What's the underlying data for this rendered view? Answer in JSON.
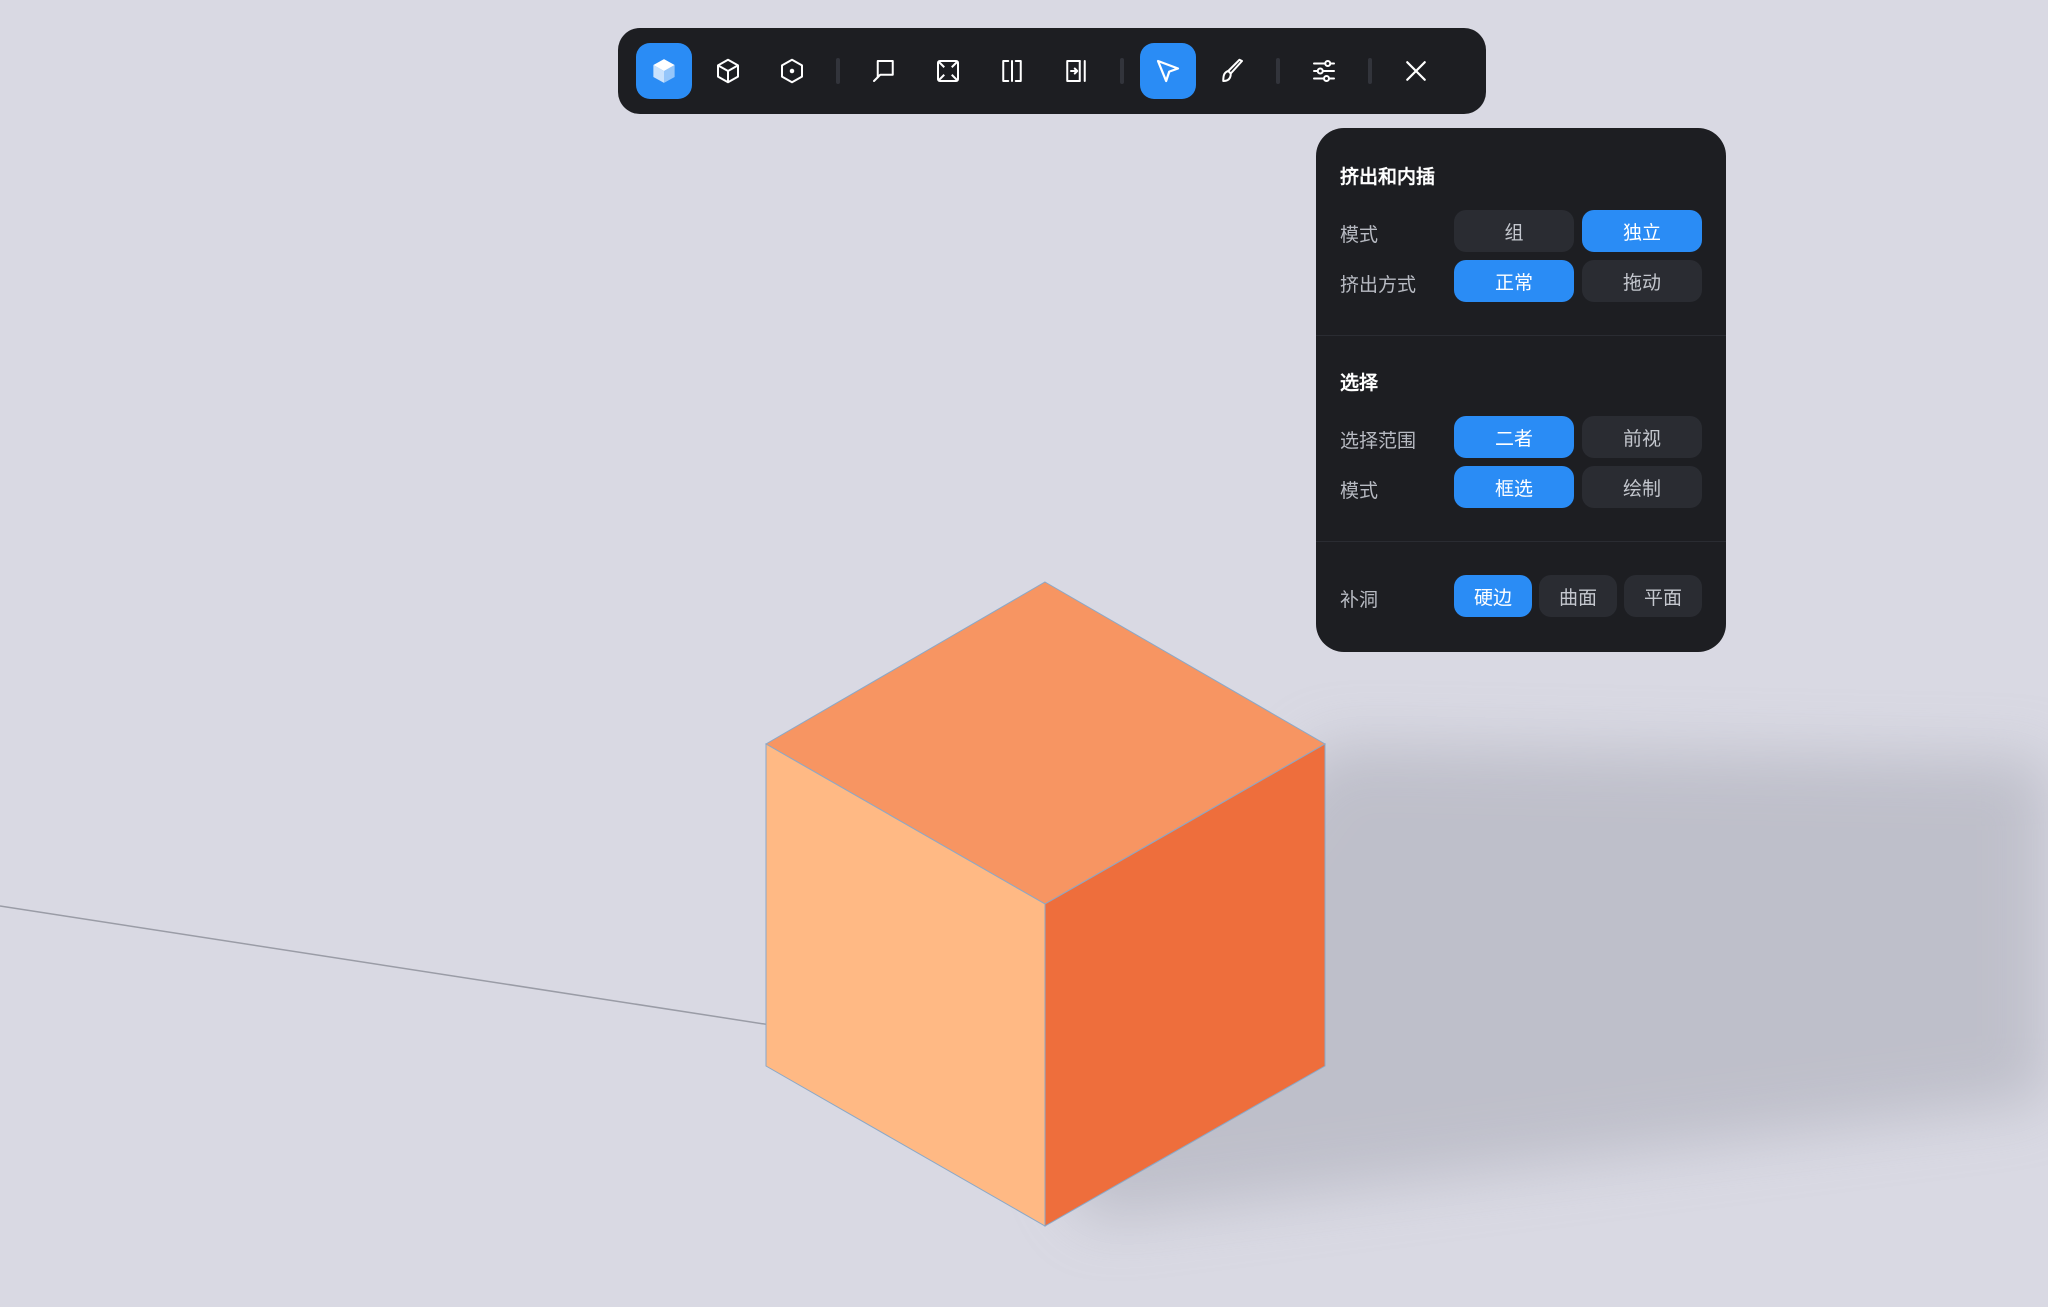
{
  "toolbar": {
    "tools": [
      {
        "icon": "cube-solid-icon",
        "active": true
      },
      {
        "icon": "cube-wireframe-icon",
        "active": false
      },
      {
        "icon": "cube-vertex-icon",
        "active": false
      },
      {
        "icon": "lasso-icon",
        "active": false
      },
      {
        "icon": "box-select-icon",
        "active": false
      },
      {
        "icon": "split-icon",
        "active": false
      },
      {
        "icon": "loop-cut-icon",
        "active": false
      },
      {
        "icon": "pointer-icon",
        "active": true
      },
      {
        "icon": "brush-icon",
        "active": false
      },
      {
        "icon": "sliders-icon",
        "active": false
      },
      {
        "icon": "close-icon",
        "active": false
      }
    ]
  },
  "panel": {
    "extrude": {
      "title": "挤出和内插",
      "mode_label": "模式",
      "mode_options": [
        "组",
        "独立"
      ],
      "mode_selected": "独立",
      "method_label": "挤出方式",
      "method_options": [
        "正常",
        "拖动"
      ],
      "method_selected": "正常"
    },
    "selection": {
      "title": "选择",
      "range_label": "选择范围",
      "range_options": [
        "二者",
        "前视"
      ],
      "range_selected": "二者",
      "mode_label": "模式",
      "mode_options": [
        "框选",
        "绘制"
      ],
      "mode_selected": "框选"
    },
    "fill_holes": {
      "label": "补洞",
      "options": [
        "硬边",
        "曲面",
        "平面"
      ],
      "selected": "硬边"
    }
  },
  "colors": {
    "background": "#d9d9e3",
    "panel": "#1d1e22",
    "accent": "#2a8cf5",
    "cube_top": "#f79562",
    "cube_left": "#ffb984",
    "cube_right": "#ee6e3c"
  }
}
